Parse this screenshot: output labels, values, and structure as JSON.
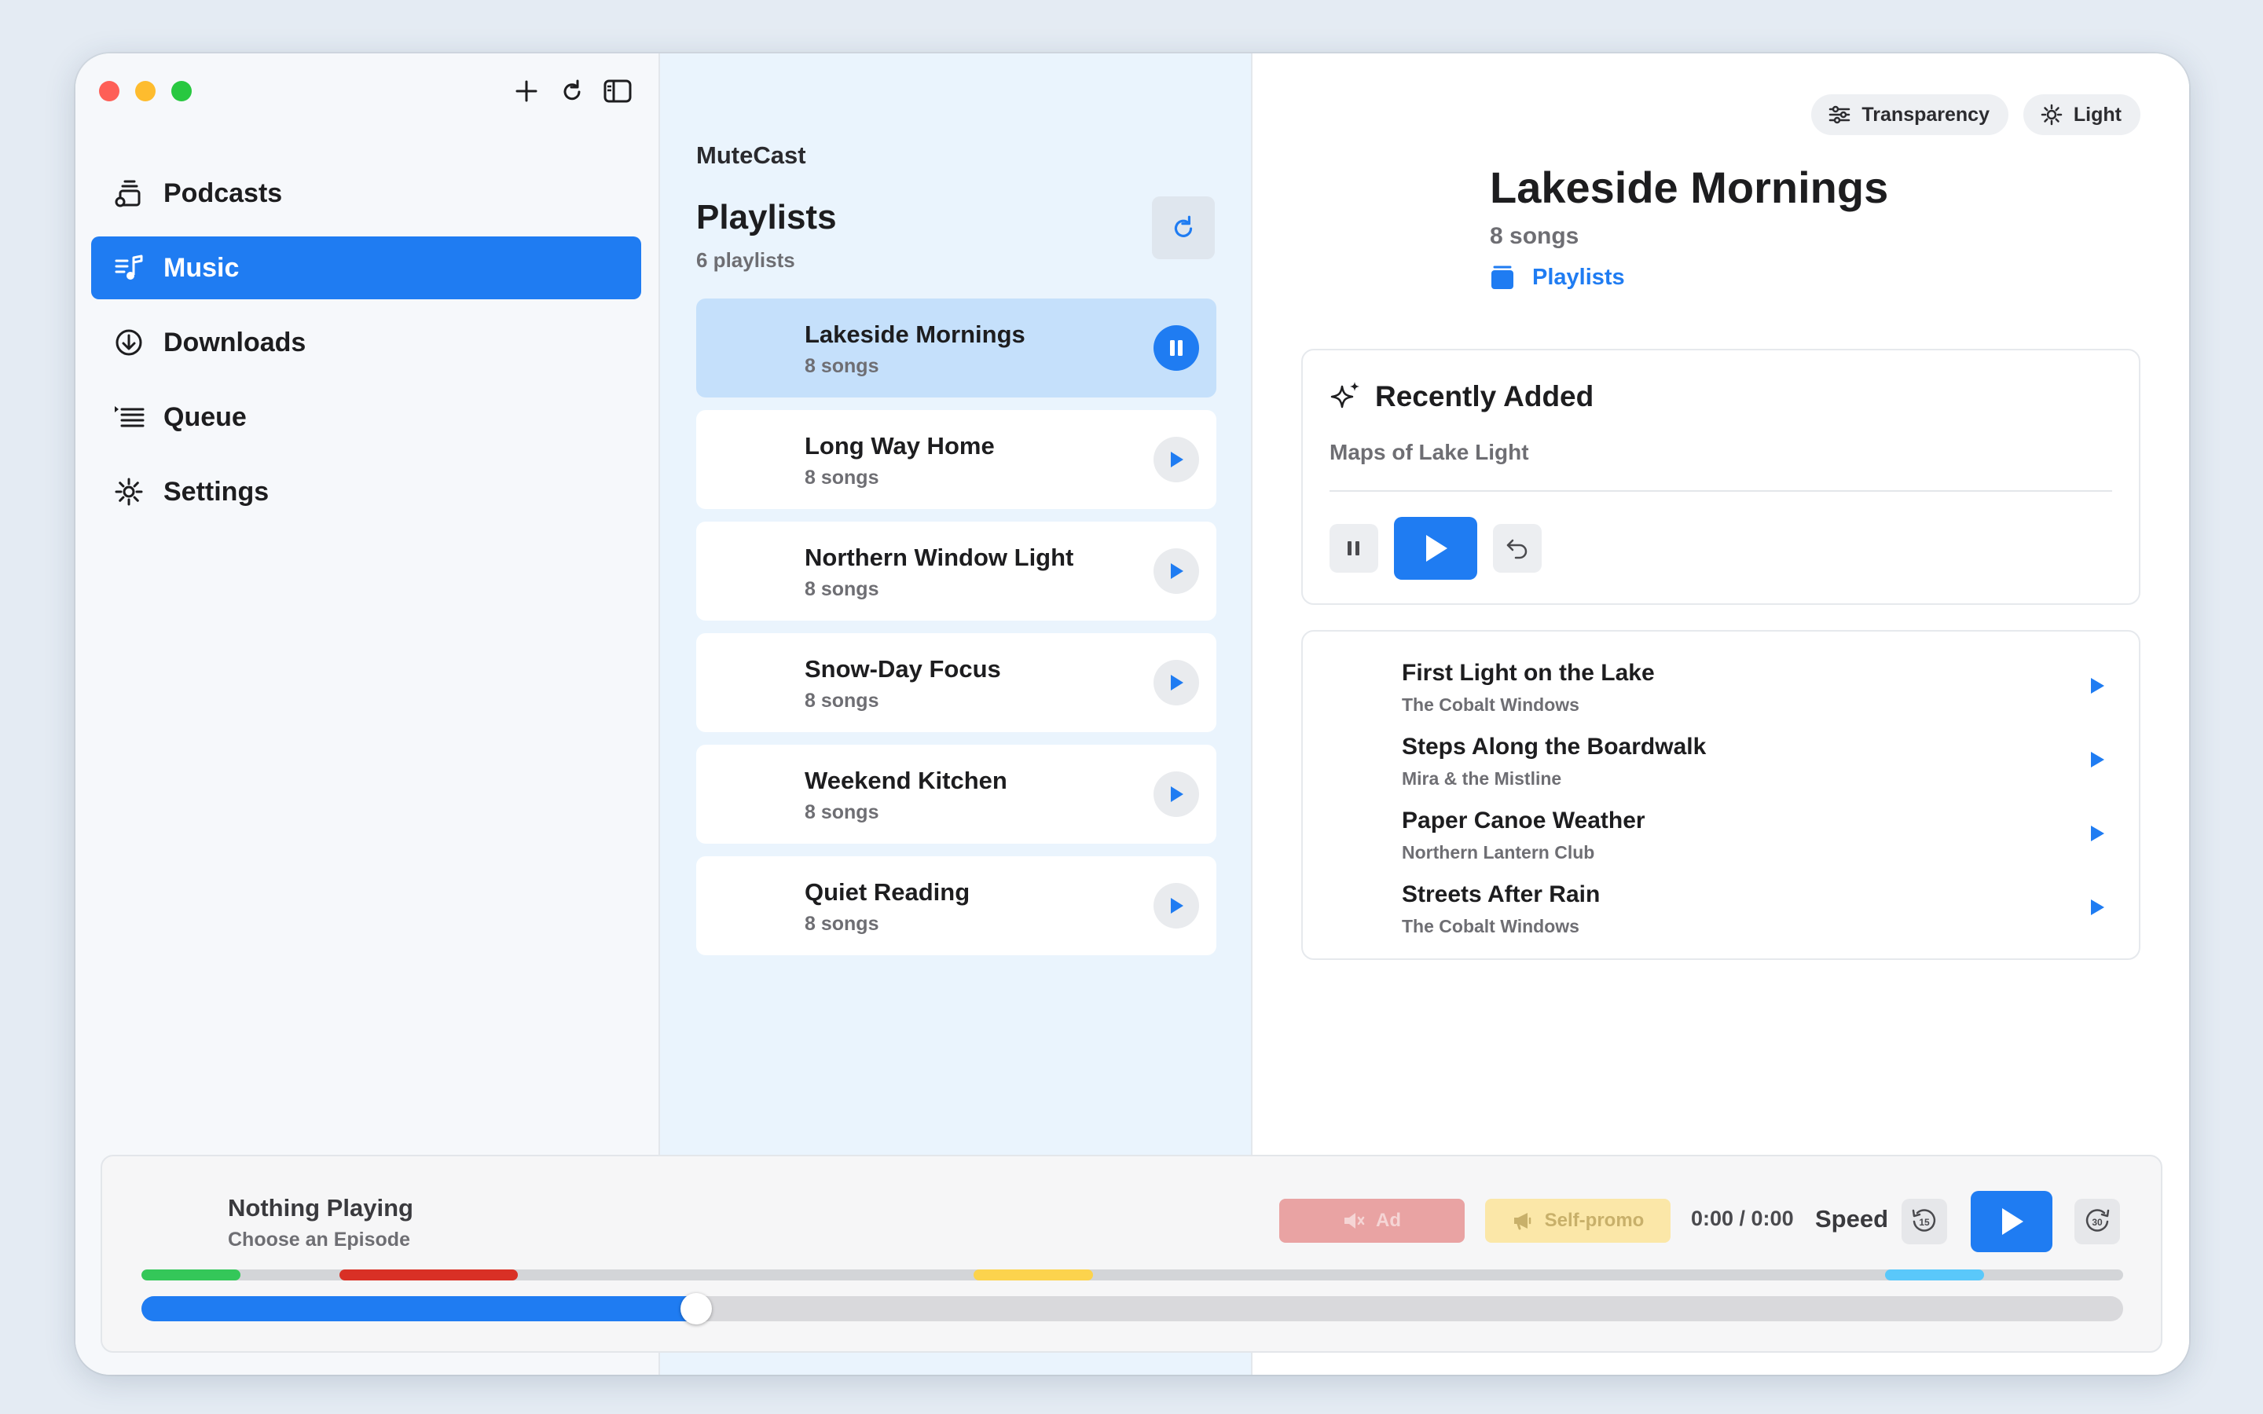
{
  "sidebar": {
    "items": [
      {
        "label": "Podcasts",
        "icon": "podcasts-icon"
      },
      {
        "label": "Music",
        "icon": "music-note-icon",
        "active": true
      },
      {
        "label": "Downloads",
        "icon": "download-circle-icon"
      },
      {
        "label": "Queue",
        "icon": "queue-list-icon"
      },
      {
        "label": "Settings",
        "icon": "gear-icon"
      }
    ],
    "tools": [
      "plus-icon",
      "refresh-icon",
      "sidebar-toggle-icon"
    ]
  },
  "middle": {
    "app_name": "MuteCast",
    "title": "Playlists",
    "count": "6 playlists",
    "playlists": [
      {
        "name": "Lakeside Mornings",
        "sub": "8 songs",
        "state": "playing"
      },
      {
        "name": "Long Way Home",
        "sub": "8 songs",
        "state": "paused"
      },
      {
        "name": "Northern Window Light",
        "sub": "8 songs",
        "state": "paused"
      },
      {
        "name": "Snow-Day Focus",
        "sub": "8 songs",
        "state": "paused"
      },
      {
        "name": "Weekend Kitchen",
        "sub": "8 songs",
        "state": "paused"
      },
      {
        "name": "Quiet Reading",
        "sub": "8 songs",
        "state": "paused"
      }
    ]
  },
  "detail": {
    "transparency_label": "Transparency",
    "theme_label": "Light",
    "title": "Lakeside Mornings",
    "sub": "8 songs",
    "link": "Playlists",
    "recent": {
      "heading": "Recently Added",
      "subtitle": "Maps of Lake Light"
    },
    "tracks": [
      {
        "name": "First Light on the Lake",
        "artist": "The Cobalt Windows"
      },
      {
        "name": "Steps Along the Boardwalk",
        "artist": "Mira & the Mistline"
      },
      {
        "name": "Paper Canoe Weather",
        "artist": "Northern Lantern Club"
      },
      {
        "name": "Streets After Rain",
        "artist": "The Cobalt Windows"
      }
    ]
  },
  "player": {
    "title": "Nothing Playing",
    "subtitle": "Choose an Episode",
    "ad_label": "Ad",
    "promo_label": "Self-promo",
    "time": "0:00 / 0:00",
    "speed_label": "Speed",
    "skip_back": "15",
    "skip_forward": "30",
    "progress": 0.28,
    "segments": [
      {
        "kind": "green",
        "start": 0.0,
        "end": 0.05,
        "color": "#34c759"
      },
      {
        "kind": "red",
        "start": 0.1,
        "end": 0.19,
        "color": "#d93025"
      },
      {
        "kind": "yellow",
        "start": 0.42,
        "end": 0.48,
        "color": "#fcd34d"
      },
      {
        "kind": "cyan",
        "start": 0.88,
        "end": 0.93,
        "color": "#5ac8fa"
      }
    ]
  },
  "colors": {
    "accent": "#1f7cf2",
    "active_row": "#c5e0fb"
  }
}
